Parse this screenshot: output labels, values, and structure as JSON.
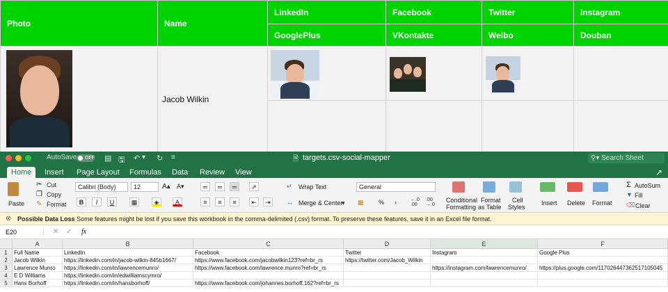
{
  "report": {
    "headers": {
      "photo": "Photo",
      "name": "Name",
      "linkedin": "LinkedIn",
      "facebook": "Facebook",
      "twitter": "Twitter",
      "instagram": "Instagram",
      "googleplus": "GooglePlus",
      "vkontakte": "VKontakte",
      "weibo": "Weibo",
      "douban": "Douban"
    },
    "row": {
      "name": "Jacob Wilkin"
    },
    "colors": {
      "header_bg": "#00d400",
      "row_bg": "#f2f2f2"
    }
  },
  "excel": {
    "titlebar": {
      "autosave_label": "AutoSave",
      "autosave_state": "OFF",
      "title": "targets.csv-social-mapper",
      "search_placeholder": "Search Sheet"
    },
    "tabs": [
      "Home",
      "Insert",
      "Page Layout",
      "Formulas",
      "Data",
      "Review",
      "View"
    ],
    "ribbon": {
      "paste": "Paste",
      "cut": "Cut",
      "copy": "Copy",
      "format": "Format",
      "font_name": "Calibri (Body)",
      "font_size": "12",
      "wrap_text": "Wrap Text",
      "merge_center": "Merge & Center",
      "number_format": "General",
      "conditional_formatting_1": "Conditional",
      "conditional_formatting_2": "Formatting",
      "format_as_table_1": "Format",
      "format_as_table_2": "as Table",
      "cell_styles_1": "Cell",
      "cell_styles_2": "Styles",
      "insert": "Insert",
      "delete": "Delete",
      "format_cells": "Format",
      "autosum": "AutoSum",
      "fill": "Fill",
      "clear": "Clear",
      "bold": "B",
      "italic": "I",
      "underline": "U"
    },
    "warning": {
      "title": "Possible Data Loss",
      "message": "Some features might be lost if you save this workbook in the comma-delimited (.csv) format. To preserve these features, save it in an Excel file format."
    },
    "formula_bar": {
      "cell_ref": "E20",
      "fx": "fx"
    },
    "columns": [
      "A",
      "B",
      "C",
      "D",
      "E",
      "F"
    ],
    "rows": [
      {
        "num": "1",
        "cells": [
          "Full Name",
          "LinkedIn",
          "Facebook",
          "Twitter",
          "Instagram",
          "Google Plus"
        ]
      },
      {
        "num": "2",
        "cells": [
          "Jacob Wilkin",
          "https://linkedin.com/in/jacob-wilkin-845b1667/",
          "https://www.facebook.com/jacobwilkin123?ref=br_rs",
          "https://twitter.com/Jacob_Wilkin",
          "",
          ""
        ]
      },
      {
        "num": "3",
        "cells": [
          "Lawrence Munro",
          "https://linkedin.com/in/lawrencemunro/",
          "https://www.facebook.com/lawrence.munro?ref=br_rs",
          "",
          "https://instagram.com/lawrencemunro/",
          "https://plus.google.com/117026447362517105045"
        ]
      },
      {
        "num": "4",
        "cells": [
          "E D Williams",
          "https://linkedin.com/in/edwilliamscymro/",
          "",
          "",
          "",
          ""
        ]
      },
      {
        "num": "5",
        "cells": [
          "Hans Borhoff",
          "https://linkedin.com/in/hansborhoff/",
          "https://www.facebook.com/johannes.borhoff.162?ref=br_rs",
          "",
          "",
          ""
        ]
      }
    ]
  }
}
